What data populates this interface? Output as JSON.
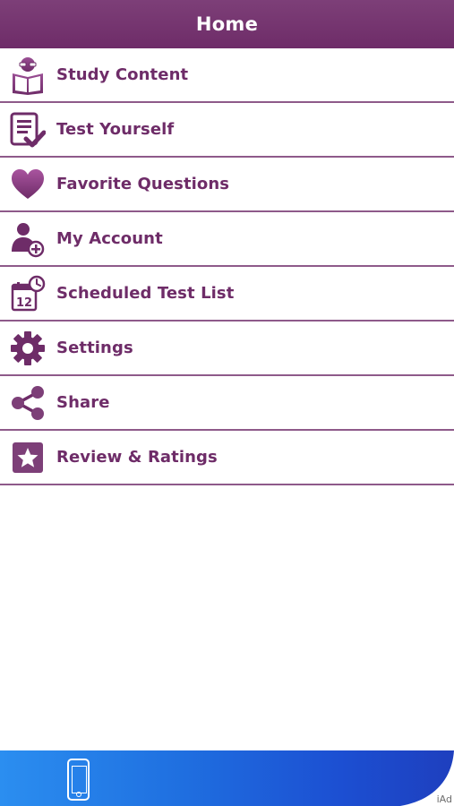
{
  "navbar": {
    "title": "Home"
  },
  "menu": {
    "items": [
      {
        "label": "Study Content",
        "icon": "reader-book-icon"
      },
      {
        "label": "Test Yourself",
        "icon": "checklist-icon"
      },
      {
        "label": "Favorite Questions",
        "icon": "heart-icon"
      },
      {
        "label": "My Account",
        "icon": "user-add-icon"
      },
      {
        "label": "Scheduled Test List",
        "icon": "calendar-clock-icon"
      },
      {
        "label": "Settings",
        "icon": "gear-icon"
      },
      {
        "label": "Share",
        "icon": "share-icon"
      },
      {
        "label": "Review & Ratings",
        "icon": "star-icon"
      }
    ]
  },
  "calendar_icon": {
    "day": "12"
  },
  "ad": {
    "label": "iAd"
  },
  "colors": {
    "accent": "#6e2c68",
    "divider": "#8e5a8a",
    "ad_blue": "#1f6fe0"
  }
}
